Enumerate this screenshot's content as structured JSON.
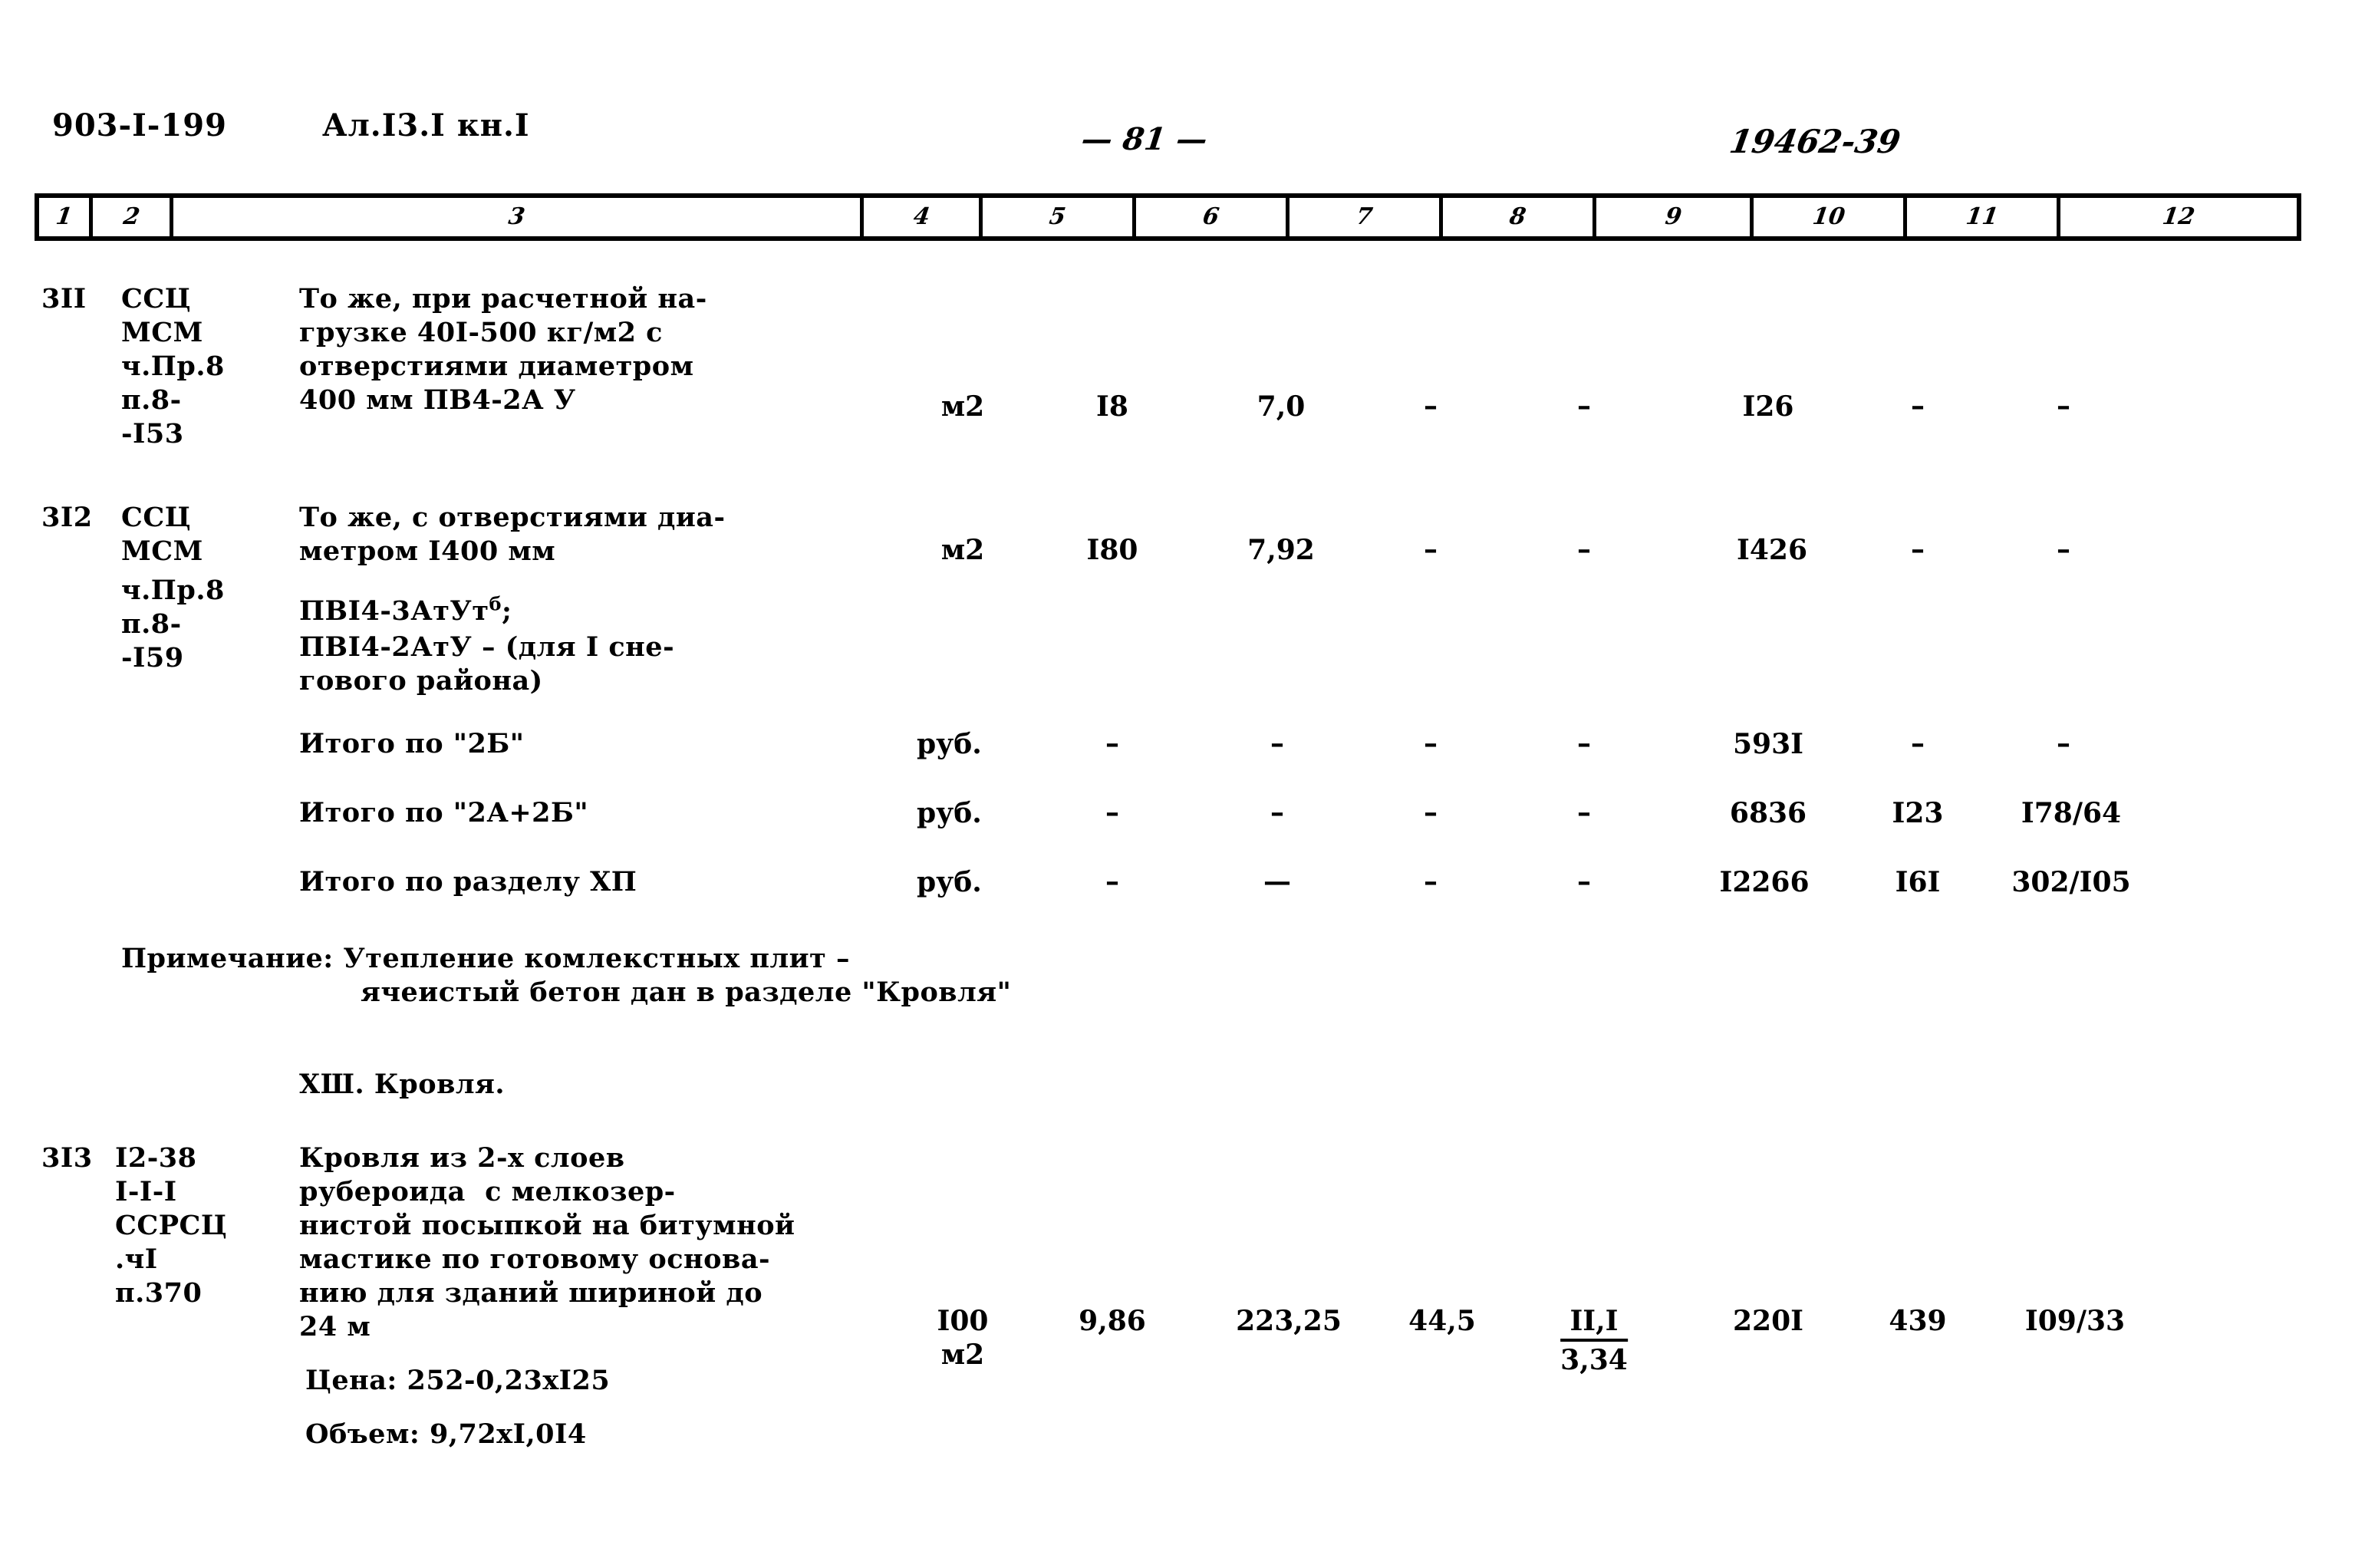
{
  "header": {
    "project_code": "903-I-199",
    "album": "Ал.I3.I кн.I",
    "page_number": "— 81 —",
    "doc_code": "19462-39"
  },
  "table": {
    "column_numbers": [
      "1",
      "2",
      "3",
      "4",
      "5",
      "6",
      "7",
      "8",
      "9",
      "10",
      "11",
      "12"
    ],
    "rows": [
      {
        "num": "3II",
        "code_lines": [
          "ССЦ",
          "МСМ",
          "ч.Пр.8",
          "п.8-",
          "-I53"
        ],
        "description_lines": [
          "То же, при расчетной на-",
          "грузке 40I-500 кг/м2 с",
          "отверстиями диаметром",
          "400 мм ПВ4-2А У"
        ],
        "unit": "м2",
        "c5": "I8",
        "c6": "7,0",
        "c7": "–",
        "c8": "–",
        "c9": "I26",
        "c10": "–",
        "c11": "–",
        "c12": ""
      },
      {
        "num": "3I2",
        "code_lines": [
          "ССЦ",
          "МСМ",
          "ч.Пр.8",
          "п.8-",
          "-I59"
        ],
        "description_lines": [
          "То же, с отверстиями диа-",
          "метром I400 мм"
        ],
        "description_extra": [
          "ПВI4-3АтУт",
          "ПВI4-2АтУ – (для I сне-",
          "гового района)"
        ],
        "superscript": "б",
        "semicolon": ";",
        "unit": "м2",
        "c5": "I80",
        "c6": "7,92",
        "c7": "–",
        "c8": "–",
        "c9": "I426",
        "c10": "–",
        "c11": "–",
        "c12": ""
      }
    ],
    "totals": [
      {
        "label": "Итого по \"2Б\"",
        "unit": "руб.",
        "c5": "–",
        "c6": "–",
        "c7": "–",
        "c8": "–",
        "c9": "593I",
        "c10": "–",
        "c11": "–",
        "c12": ""
      },
      {
        "label": "Итого по \"2А+2Б\"",
        "unit": "руб.",
        "c5": "–",
        "c6": "–",
        "c7": "–",
        "c8": "–",
        "c9": "6836",
        "c10": "I23",
        "c11": "I78/64",
        "c12": ""
      },
      {
        "label": "Итого по разделу ХП",
        "unit": "руб.",
        "c5": "–",
        "c6": "—",
        "c7": "–",
        "c8": "–",
        "c9": "I2266",
        "c10": "I6I",
        "c11": "302/I05",
        "c12": ""
      }
    ],
    "note": {
      "line1": "Примечание: Утепление комлекстных плит –",
      "line2": "ячеистый бетон дан в разделе \"Кровля\""
    },
    "section_heading": "ХШ. Кровля.",
    "row_313": {
      "num": "3I3",
      "code_lines": [
        "I2-38",
        "I-I-I",
        "ССРСЦ",
        ".чI",
        "п.370"
      ],
      "description_lines": [
        "Кровля из 2-х слоев",
        "рубероида  с мелкозер-",
        "нистой посыпкой на битумной",
        "мастике по готовому основа-",
        "нию для зданий шириной до",
        "24 м"
      ],
      "price_line": "Цена: 252-0,23хI25",
      "volume_line": "Объем: 9,72хI,0I4",
      "unit_line1": "I00",
      "unit_line2": "м2",
      "c5": "9,86",
      "c6": "223,25",
      "c7": "44,5",
      "c8_top": "II,I",
      "c8_bottom": "3,34",
      "c9": "220I",
      "c10": "439",
      "c11": "I09/33",
      "c12": ""
    }
  }
}
